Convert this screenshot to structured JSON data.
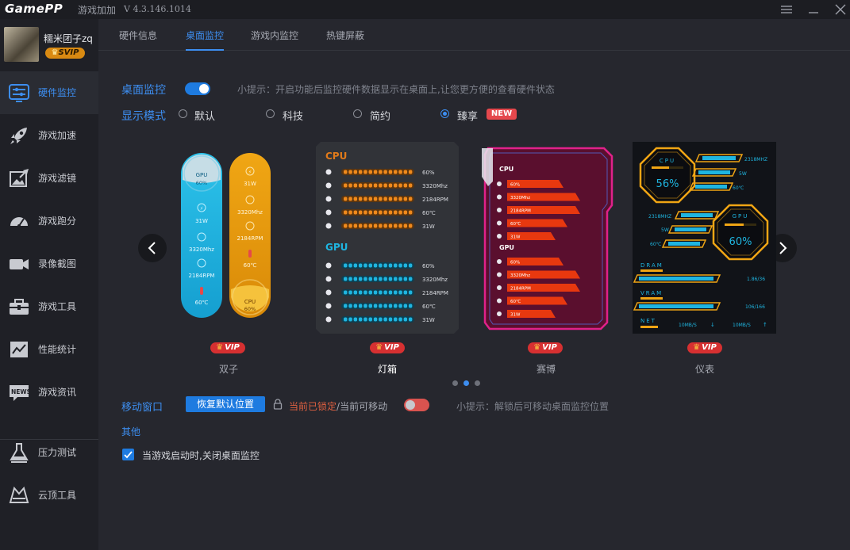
{
  "app": {
    "logo": "GamePP",
    "name": "游戏加加",
    "version": "V 4.3.146.1014"
  },
  "user": {
    "name": "糯米团子zq",
    "badge": "SVIP"
  },
  "sidebar": {
    "items": [
      {
        "label": "硬件监控",
        "icon": "monitor-sliders-icon",
        "active": true
      },
      {
        "label": "游戏加速",
        "icon": "rocket-icon"
      },
      {
        "label": "游戏滤镜",
        "icon": "filter-image-icon"
      },
      {
        "label": "游戏跑分",
        "icon": "speedometer-icon"
      },
      {
        "label": "录像截图",
        "icon": "video-camera-icon"
      },
      {
        "label": "游戏工具",
        "icon": "toolbox-icon"
      },
      {
        "label": "性能统计",
        "icon": "line-chart-icon"
      },
      {
        "label": "游戏资讯",
        "icon": "news-icon"
      },
      {
        "label": "压力测试",
        "icon": "flask-icon"
      },
      {
        "label": "云顶工具",
        "icon": "crown-tool-icon"
      }
    ]
  },
  "tabs": [
    {
      "label": "硬件信息"
    },
    {
      "label": "桌面监控",
      "active": true
    },
    {
      "label": "游戏内监控"
    },
    {
      "label": "热键屏蔽"
    }
  ],
  "desktop_monitor": {
    "label": "桌面监控",
    "enabled": true,
    "hint": "小提示：开启功能后监控硬件数据显示在桌面上,让您更方便的查看硬件状态"
  },
  "display_mode": {
    "label": "显示模式",
    "options": [
      {
        "label": "默认"
      },
      {
        "label": "科技"
      },
      {
        "label": "简约"
      },
      {
        "label": "臻享",
        "selected": true,
        "badge": "NEW"
      }
    ]
  },
  "skins": [
    {
      "name": "双子",
      "vip": "VIP",
      "gpu": {
        "label": "GPU",
        "load": "60%",
        "power": "31W",
        "clock": "3320Mhz",
        "fan": "2184RPM",
        "temp": "60℃"
      },
      "cpu": {
        "label": "CPU",
        "load": "60%",
        "power": "31W",
        "clock": "3320Mhz",
        "fan": "2184RPM",
        "temp": "60℃"
      }
    },
    {
      "name": "灯箱",
      "vip": "VIP",
      "current": true,
      "cpu": {
        "label": "CPU",
        "rows": [
          "60%",
          "3320Mhz",
          "2184RPM",
          "60℃",
          "31W"
        ]
      },
      "gpu": {
        "label": "GPU",
        "rows": [
          "60%",
          "3320Mhz",
          "2184RPM",
          "60℃",
          "31W"
        ]
      }
    },
    {
      "name": "赛博",
      "vip": "VIP",
      "cpu": {
        "label": "CPU",
        "rows": [
          "60%",
          "3320Mhz",
          "2184RPM",
          "60℃",
          "31W"
        ]
      },
      "gpu": {
        "label": "GPU",
        "rows": [
          "60%",
          "3320Mhz",
          "2184RPM",
          "60℃",
          "31W"
        ]
      }
    },
    {
      "name": "仪表",
      "vip": "VIP",
      "cpu": {
        "label": "CPU",
        "load": "56%",
        "clock": "2318MHZ",
        "power": "5W",
        "temp": "60℃"
      },
      "gpu": {
        "label": "GPU",
        "load": "60%",
        "clock": "2318MHZ",
        "power": "5W",
        "temp": "60℃"
      },
      "dram": {
        "label": "DRAM",
        "value": "1.86/36"
      },
      "vram": {
        "label": "VRAM",
        "value": "106/166"
      },
      "net": {
        "label": "NET",
        "down": "10MB/S",
        "up": "10MB/S"
      }
    }
  ],
  "carousel": {
    "pages": 3,
    "active": 1
  },
  "move_window": {
    "label": "移动窗口",
    "reset_button": "恢复默认位置",
    "locked_text": "当前已锁定",
    "separator": "/",
    "movable_text": "当前可移动",
    "toggle_on": false,
    "hint": "小提示：解锁后可移动桌面监控位置"
  },
  "other": {
    "label": "其他",
    "checkbox_label": "当游戏启动时,关闭桌面监控",
    "checked": true
  },
  "colors": {
    "accent": "#3d8ef0",
    "cyan": "#1fb5e0",
    "orange": "#e59a0e",
    "red_toggle": "#e5484d",
    "cyber_pink": "#e0218a"
  }
}
